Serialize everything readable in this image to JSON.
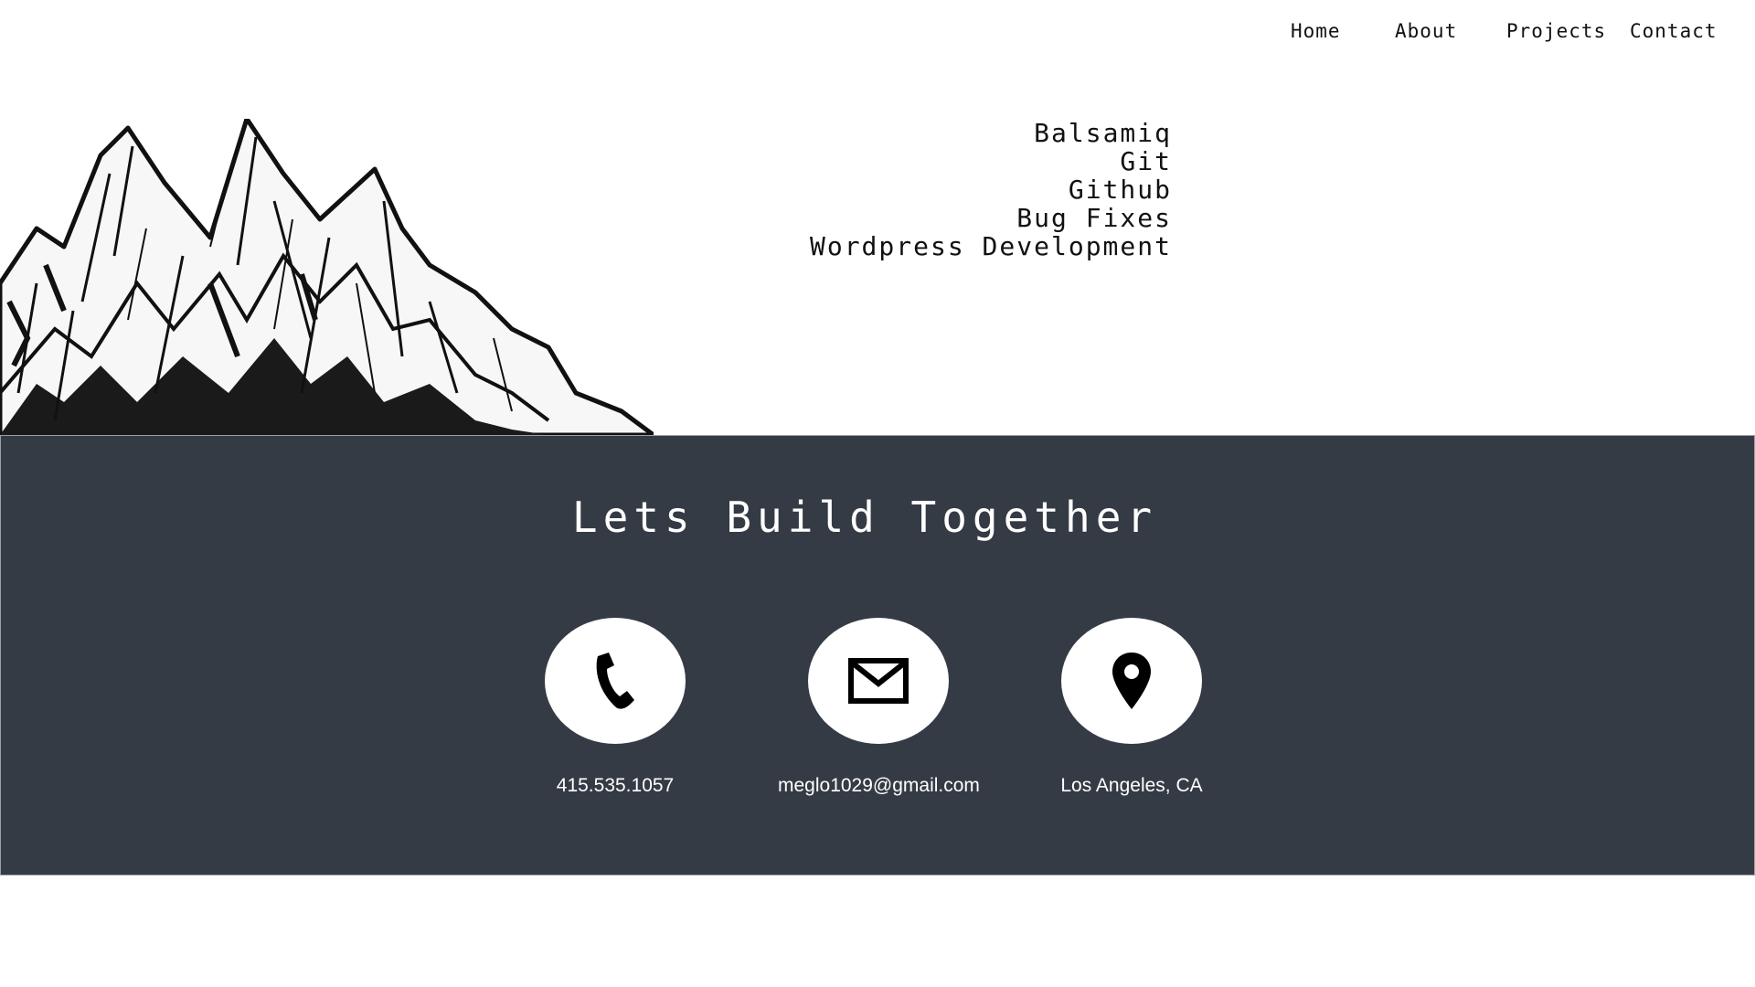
{
  "nav": {
    "items": [
      {
        "label": "Home"
      },
      {
        "label": "About"
      },
      {
        "label": "Projects"
      },
      {
        "label": "Contact"
      }
    ]
  },
  "skills": [
    "Balsamiq",
    "Git",
    "Github",
    "Bug Fixes",
    "Wordpress Development"
  ],
  "contact": {
    "heading": "Lets Build Together",
    "items": [
      {
        "icon": "phone-icon",
        "label": "415.535.1057"
      },
      {
        "icon": "envelope-icon",
        "label": "meglo1029@gmail.com"
      },
      {
        "icon": "map-pin-icon",
        "label": "Los Angeles, CA"
      }
    ],
    "background": "#353b45"
  }
}
